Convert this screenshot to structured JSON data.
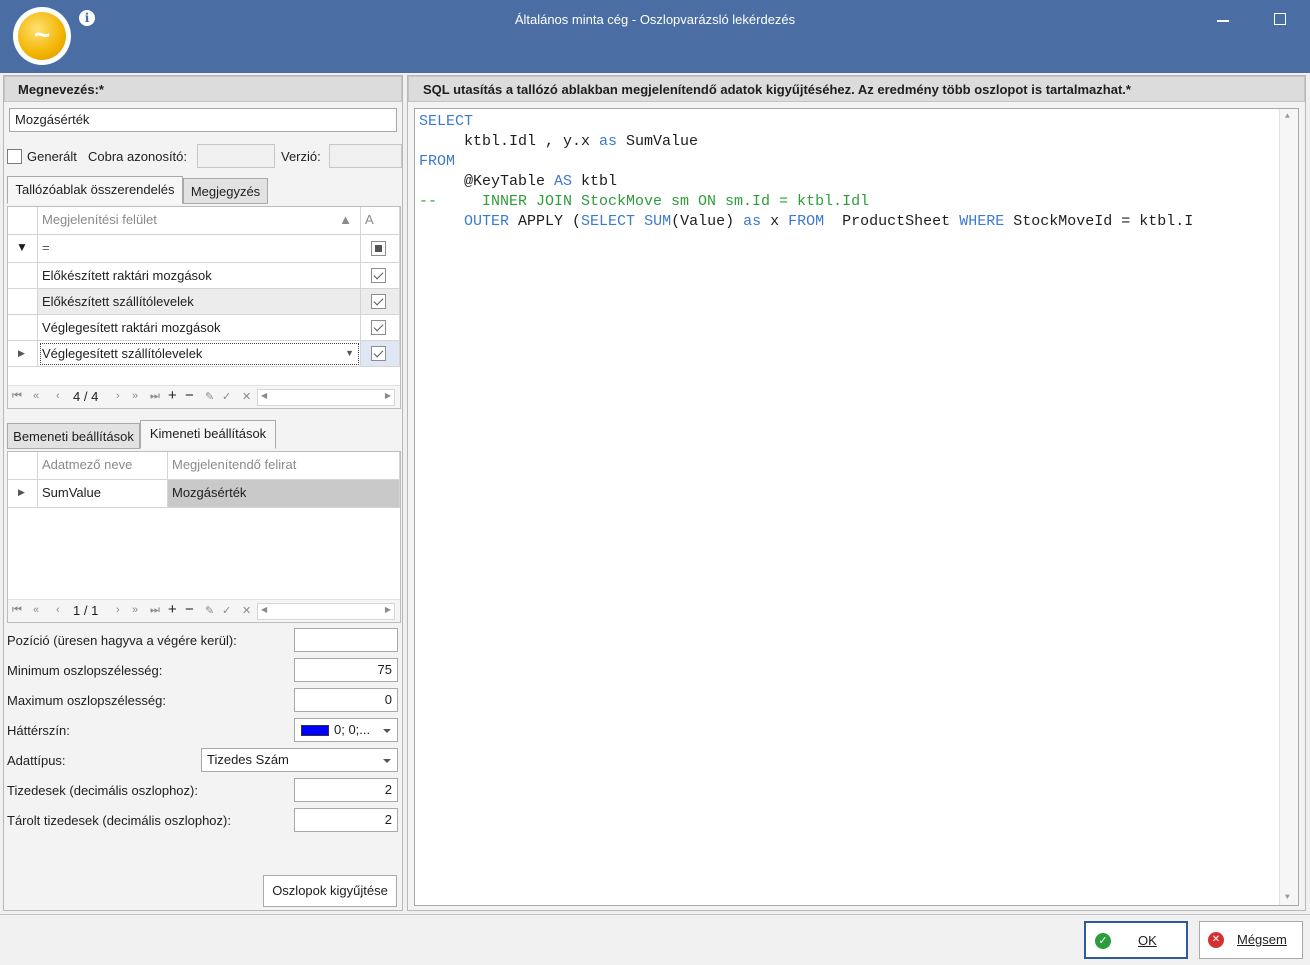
{
  "window": {
    "title": "Általános minta cég - Oszlopvarázsló lekérdezés"
  },
  "name_section": {
    "header": "Megnevezés:*",
    "value": "Mozgásérték",
    "generated_label": "Generált",
    "cobra_id_label": "Cobra azonosító:",
    "cobra_id_value": "",
    "version_label": "Verzió:",
    "version_value": ""
  },
  "top_tabs": [
    {
      "label": "Tallózóablak összerendelés",
      "active": true
    },
    {
      "label": "Megjegyzés",
      "active": false
    }
  ],
  "surface_grid": {
    "columns": [
      "Megjelenítési felület",
      "A"
    ],
    "filter_symbol": "=",
    "rows": [
      {
        "label": "Előkészített raktári mozgások",
        "checked": true
      },
      {
        "label": "Előkészített szállítólevelek",
        "checked": true
      },
      {
        "label": "Véglegesített raktári mozgások",
        "checked": true
      },
      {
        "label": "Véglegesített szállítólevelek",
        "checked": true,
        "current": true
      }
    ],
    "navigator": {
      "position": "4 / 4"
    }
  },
  "bottom_tabs": [
    {
      "label": "Bemeneti beállítások",
      "active": false
    },
    {
      "label": "Kimeneti beállítások",
      "active": true
    }
  ],
  "output_grid": {
    "columns": [
      "Adatmező neve",
      "Megjelenítendő felirat"
    ],
    "rows": [
      {
        "field": "SumValue",
        "caption": "Mozgásérték"
      }
    ],
    "navigator": {
      "position": "1 / 1"
    }
  },
  "properties": {
    "position_label": "Pozíció (üresen hagyva a végére kerül):",
    "position_value": "",
    "min_width_label": "Minimum oszlopszélesség:",
    "min_width_value": "75",
    "max_width_label": "Maximum oszlopszélesség:",
    "max_width_value": "0",
    "bgcolor_label": "Háttérszín:",
    "bgcolor_value": "0; 0;...",
    "bgcolor_swatch": "#0000ff",
    "datatype_label": "Adattípus:",
    "datatype_value": "Tizedes Szám",
    "decimals_label": "Tizedesek (decimális oszlophoz):",
    "decimals_value": "2",
    "stored_decimals_label": "Tárolt tizedesek (decimális oszlophoz):",
    "stored_decimals_value": "2",
    "collect_button": "Oszlopok kigyűjtése"
  },
  "sql_section": {
    "header": "SQL utasítás a tallózó ablakban megjelenítendő adatok kigyűjtéséhez. Az eredmény több oszlopot is tartalmazhat.*",
    "lines": [
      [
        {
          "t": "SELECT",
          "c": "kw"
        }
      ],
      [
        {
          "t": "     ktbl.Idl , y.x ",
          "c": ""
        },
        {
          "t": "as",
          "c": "kw"
        },
        {
          "t": " SumValue",
          "c": ""
        }
      ],
      [
        {
          "t": "FROM",
          "c": "kw"
        }
      ],
      [
        {
          "t": "     @KeyTable ",
          "c": ""
        },
        {
          "t": "AS",
          "c": "kw"
        },
        {
          "t": " ktbl",
          "c": ""
        }
      ],
      [
        {
          "t": "--     INNER JOIN StockMove sm ON sm.Id = ktbl.Idl",
          "c": "cm"
        }
      ],
      [
        {
          "t": "     ",
          "c": ""
        },
        {
          "t": "OUTER",
          "c": "kw"
        },
        {
          "t": " APPLY (",
          "c": ""
        },
        {
          "t": "SELECT",
          "c": "kw"
        },
        {
          "t": " ",
          "c": ""
        },
        {
          "t": "SUM",
          "c": "kw"
        },
        {
          "t": "(Value) ",
          "c": ""
        },
        {
          "t": "as",
          "c": "kw"
        },
        {
          "t": " x ",
          "c": ""
        },
        {
          "t": "FROM",
          "c": "kw"
        },
        {
          "t": "  ProductSheet ",
          "c": ""
        },
        {
          "t": "WHERE",
          "c": "kw"
        },
        {
          "t": " StockMoveId = ktbl.I",
          "c": ""
        }
      ]
    ]
  },
  "footer": {
    "ok_label": "OK",
    "cancel_label": "Mégsem"
  }
}
